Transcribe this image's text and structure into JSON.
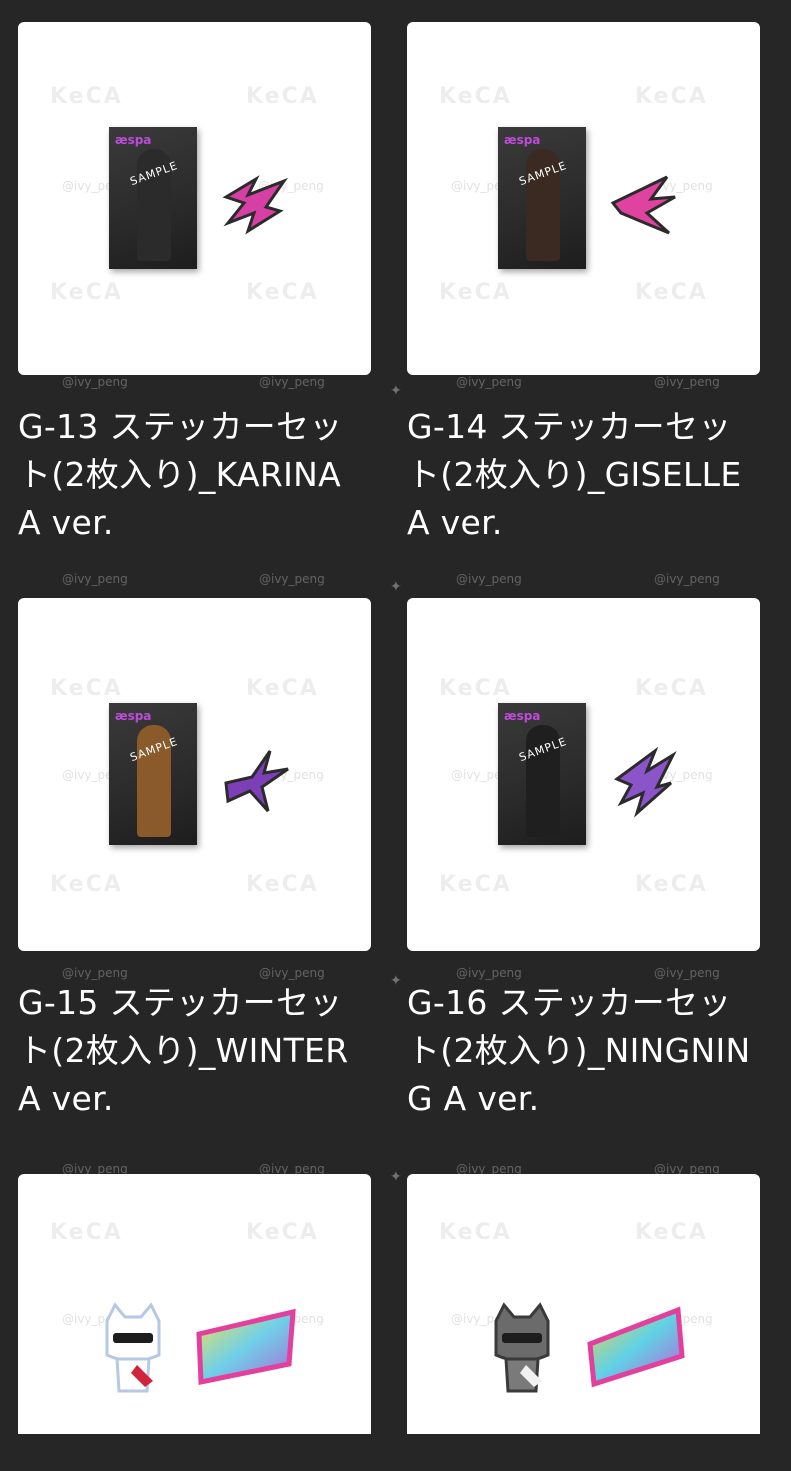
{
  "watermark": {
    "brand": "KeCA",
    "handle": "@ivy_peng",
    "sample": "SAMPLE"
  },
  "products": [
    {
      "title": "G-13 ステッカーセット(2枚入り)_KARINA A ver.",
      "figure_color": "#2b2b2b",
      "sticker_color": "#d63fa4"
    },
    {
      "title": "G-14 ステッカーセット(2枚入り)_GISELLE A ver.",
      "figure_color": "#3a2a22",
      "sticker_color": "#e0439f"
    },
    {
      "title": "G-15 ステッカーセット(2枚入り)_WINTER A ver.",
      "figure_color": "#8a5a2b",
      "sticker_color": "#7c3fb8"
    },
    {
      "title": "G-16 ステッカーセット(2枚入り)_NINGNING A ver.",
      "figure_color": "#1f1f1f",
      "sticker_color": "#8b55c9"
    },
    {
      "title": "",
      "figure_color": "#ffffff",
      "sticker_color": "#e2409c"
    },
    {
      "title": "",
      "figure_color": "#6b6b6b",
      "sticker_color": "#e2409c"
    }
  ]
}
